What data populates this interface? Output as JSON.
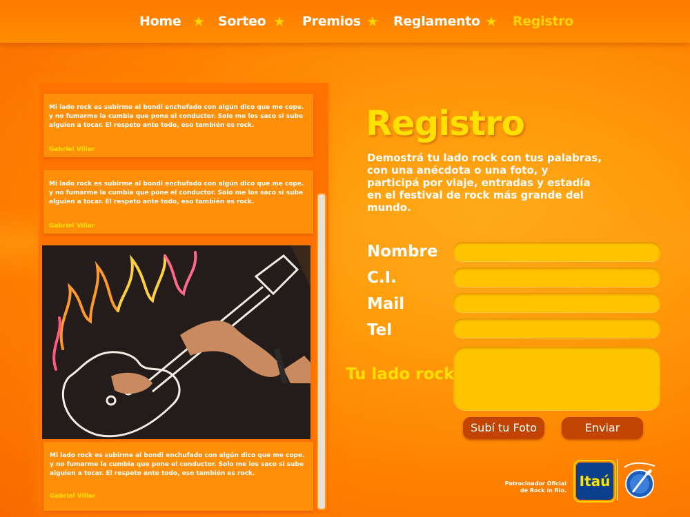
{
  "nav": {
    "items": [
      {
        "label": "Home",
        "active": false
      },
      {
        "label": "Sorteo",
        "active": false
      },
      {
        "label": "Premios",
        "active": false
      },
      {
        "label": "Reglamento",
        "active": false
      },
      {
        "label": "Registro",
        "active": true
      }
    ]
  },
  "posts": [
    {
      "text": "Mi lado rock es subirme al bondi enchufado con algún dico que me cope. y no fumarme la cumbia que pone el conductor. Solo  me los saco si sube alguien a tocar. El respeto  ante todo, eso también es rock.",
      "author": "Gabriel Villar"
    },
    {
      "text": "Mi lado rock es subirme al bondi enchufado con algún dico que me cope. y no fumarme la cumbia que pone el conductor. Solo  me los saco si sube alguien a tocar. El respeto  ante todo, eso también es rock.",
      "author": "Gabriel Villar"
    },
    {
      "text": "Mi lado rock es subirme al bondi enchufado con algún dico que me cope. y no fumarme la cumbia que pone el conductor. Solo  me los saco si sube alguien a tocar. El respeto  ante todo, eso también es rock.",
      "author": "Gabriel Villar"
    }
  ],
  "form": {
    "title": "Registro",
    "description": "Demostrá tu lado rock con tus palabras, con una anécdota o una foto, y participá por viaje, entradas y estadía en el festival de rock más grande del mundo.",
    "labels": {
      "nombre": "Nombre",
      "ci": "C.I.",
      "mail": "Mail",
      "tel": "Tel",
      "lado_rock": "Tu lado rock"
    },
    "upload_button": "Subí tu Foto",
    "submit_button": "Enviar"
  },
  "sponsor": {
    "text_line1": "Patrocinador Oficial",
    "text_line2": "de Rock in Rio.",
    "brand": "Itaú"
  },
  "colors": {
    "accent_yellow": "#ffe000",
    "background_orange": "#ff8c00",
    "button_brown": "#c34300",
    "field_yellow": "#ffc400"
  }
}
